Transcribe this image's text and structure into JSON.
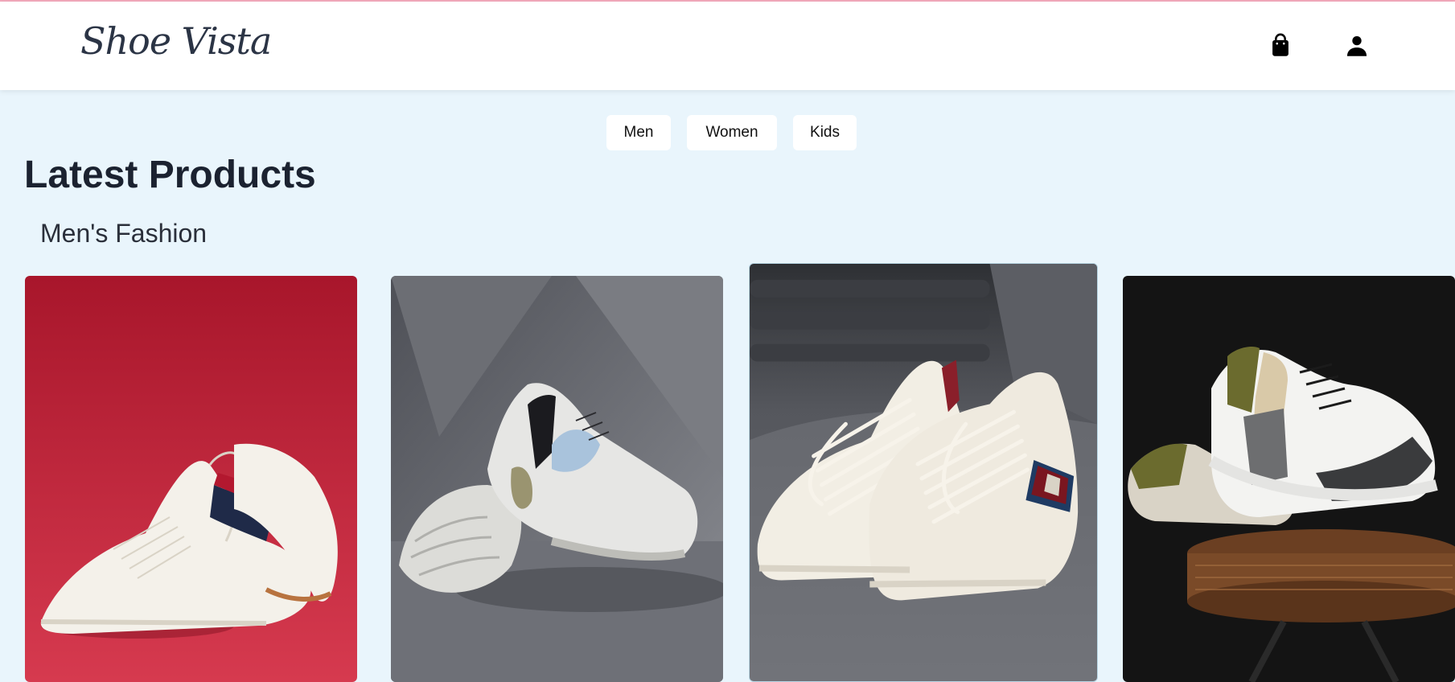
{
  "header": {
    "logo_text": "Shoe Vista",
    "cart_icon": "shopping-bag-icon",
    "user_icon": "user-icon"
  },
  "categories": [
    {
      "label": "Men"
    },
    {
      "label": "Women"
    },
    {
      "label": "Kids"
    }
  ],
  "main": {
    "title": "Latest Products",
    "section_title": "Men's Fashion"
  },
  "products": [
    {
      "background": "#c41e36",
      "shoe_color": "#f4f1ea"
    },
    {
      "background": "#5f6167",
      "shoe_color": "#e6e6e4"
    },
    {
      "background": "#55575d",
      "shoe_color": "#f2eee4"
    },
    {
      "background": "#141414",
      "shoe_color": "#f3f3f1"
    }
  ],
  "colors": {
    "page_background": "#e9f5fc",
    "header_background": "#ffffff",
    "accent_strip": "#f2a9bb",
    "title_text": "#1b2230"
  }
}
